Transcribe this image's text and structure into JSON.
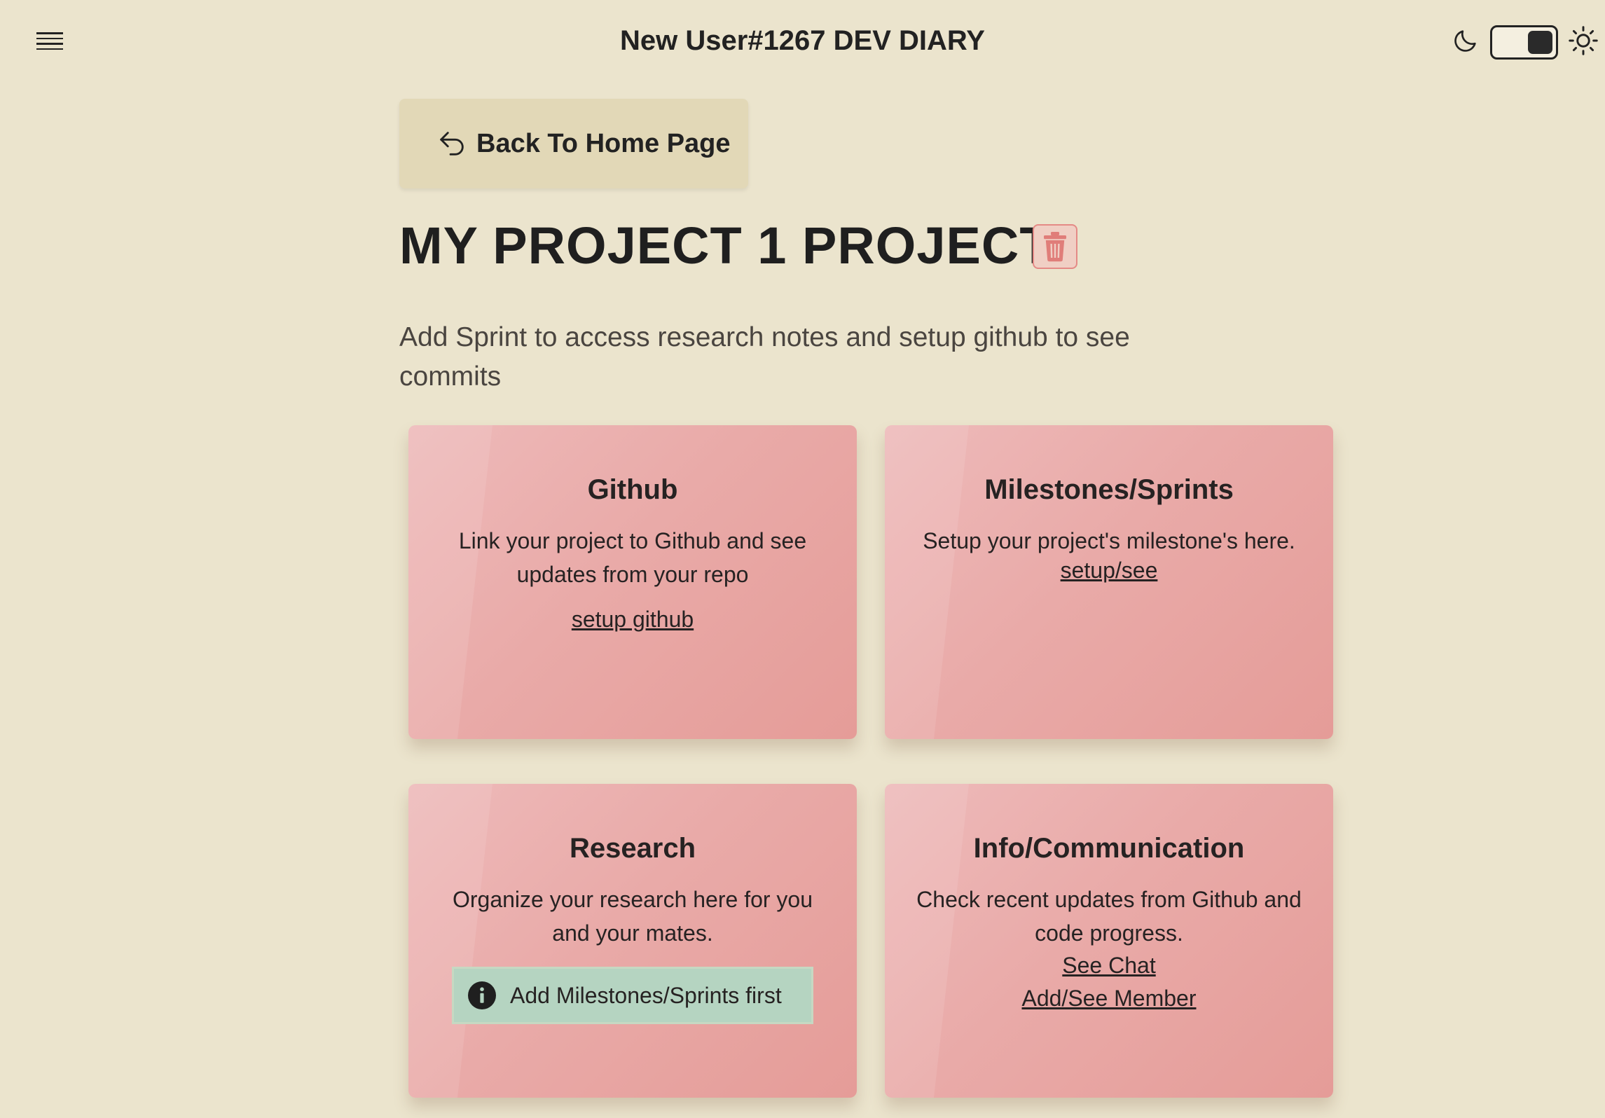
{
  "header": {
    "title": "New User#1267 DEV DIARY",
    "menu_icon": "hamburger-icon",
    "theme_toggle": {
      "left_icon": "moon-icon",
      "right_icon": "sun-icon",
      "state": "dark-knob-right"
    }
  },
  "back_button": {
    "label": "Back To Home Page",
    "icon": "back-arrow-icon"
  },
  "project": {
    "title": "MY PROJECT 1 PROJECT",
    "delete_icon": "trash-icon",
    "subtitle": "Add Sprint to access research notes and setup github to see commits"
  },
  "cards": [
    {
      "title": "Github",
      "description": "Link your project to Github and see updates from your repo",
      "links": [
        "setup github"
      ]
    },
    {
      "title": "Milestones/Sprints",
      "description": "Setup your project's milestone's here.",
      "links": [
        "setup/see"
      ]
    },
    {
      "title": "Research",
      "description": "Organize your research here for you and your mates.",
      "notice": {
        "icon": "info-icon",
        "text": "Add Milestones/Sprints first"
      }
    },
    {
      "title": "Info/Communication",
      "description": "Check recent updates from Github and code progress.",
      "links": [
        "See Chat",
        "Add/See Member"
      ]
    }
  ],
  "colors": {
    "background": "#ebe4cd",
    "back_button": "#e2d8b7",
    "card": "#e9aaa8",
    "notice": "#b5d4c1",
    "delete": "#e48a86"
  }
}
